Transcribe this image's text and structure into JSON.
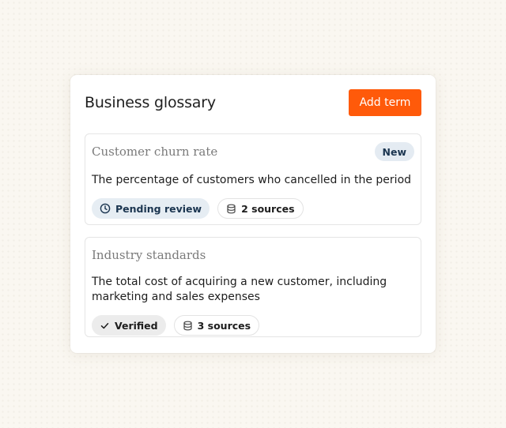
{
  "glossary": {
    "title": "Business glossary",
    "add_button_label": "Add term",
    "accent_color": "#ff5a0a",
    "terms": [
      {
        "name": "Customer churn rate",
        "badge": "New",
        "description": "The percentage of customers who cancelled in the period",
        "status": {
          "icon": "clock-icon",
          "label": "Pending review"
        },
        "sources": {
          "icon": "database-icon",
          "label": "2 sources"
        }
      },
      {
        "name": "Industry standards",
        "badge": "",
        "description_line1": "The total cost of acquiring a new customer, including",
        "description_line2": "marketing and sales expenses",
        "status": {
          "icon": "check-icon",
          "label": "Verified"
        },
        "sources": {
          "icon": "database-icon",
          "label": "3 sources"
        }
      }
    ]
  }
}
